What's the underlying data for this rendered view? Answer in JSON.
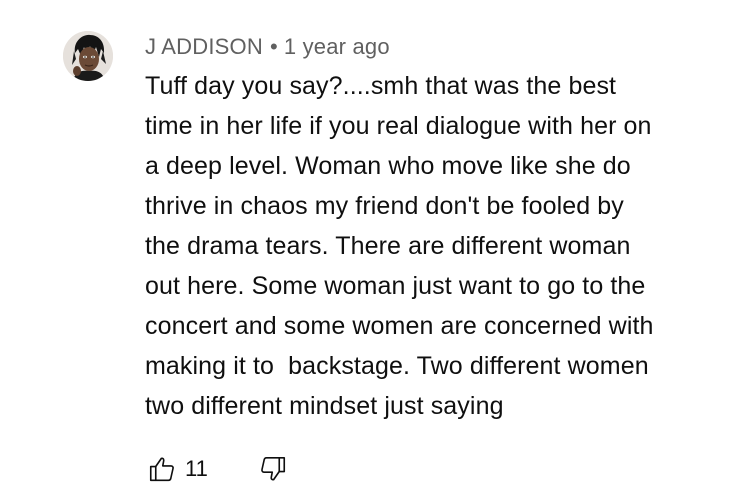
{
  "comment": {
    "author": "J ADDISON",
    "separator": "•",
    "timestamp": "1 year ago",
    "text_lines": [
      "Tuff day you say?....smh that was the best",
      "time in her life if you real dialogue with her on",
      "a deep level. Woman who move like she do",
      "thrive in chaos my friend don't be fooled by",
      "the drama tears. There are different woman",
      "out here. Some woman just want to go to the",
      "concert and some women are concerned with",
      "making it to  backstage. Two different women",
      "two different mindset just saying"
    ],
    "like_count": "11",
    "icons": {
      "like": "thumbs-up-icon",
      "dislike": "thumbs-down-icon"
    }
  }
}
